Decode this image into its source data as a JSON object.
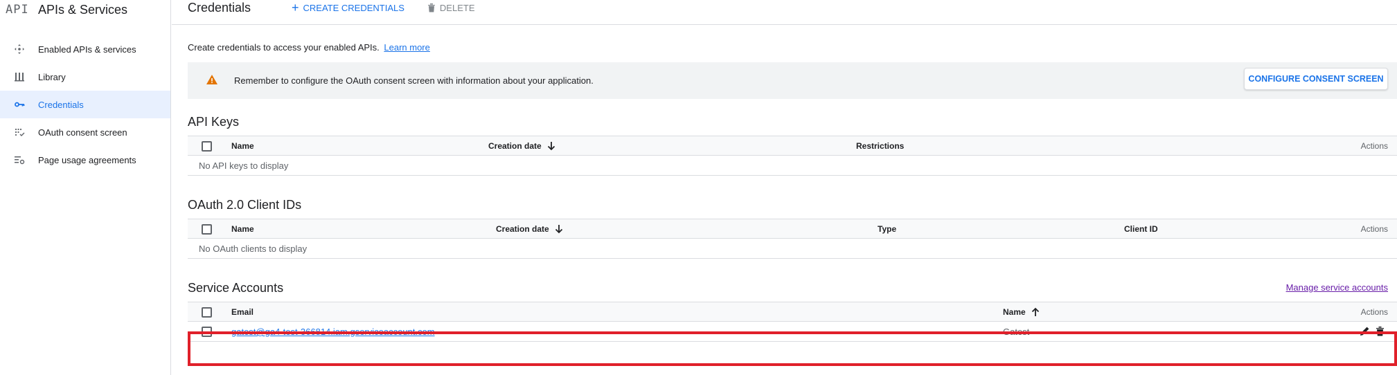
{
  "sidebar": {
    "logo": "API",
    "title": "APIs & Services",
    "items": [
      {
        "label": "Enabled APIs & services",
        "icon": "diamond-dots-icon"
      },
      {
        "label": "Library",
        "icon": "library-icon"
      },
      {
        "label": "Credentials",
        "icon": "key-icon",
        "active": true
      },
      {
        "label": "OAuth consent screen",
        "icon": "consent-dots-icon"
      },
      {
        "label": "Page usage agreements",
        "icon": "settings-list-icon"
      }
    ]
  },
  "header": {
    "title": "Credentials",
    "create_label": "CREATE CREDENTIALS",
    "delete_label": "DELETE"
  },
  "intro": {
    "text": "Create credentials to access your enabled APIs.",
    "link": "Learn more"
  },
  "banner": {
    "message": "Remember to configure the OAuth consent screen with information about your application.",
    "button": "CONFIGURE CONSENT SCREEN"
  },
  "api_keys": {
    "title": "API Keys",
    "columns": {
      "name": "Name",
      "created": "Creation date",
      "restrictions": "Restrictions",
      "actions": "Actions"
    },
    "empty": "No API keys to display"
  },
  "oauth": {
    "title": "OAuth 2.0 Client IDs",
    "columns": {
      "name": "Name",
      "created": "Creation date",
      "type": "Type",
      "client_id": "Client ID",
      "actions": "Actions"
    },
    "empty": "No OAuth clients to display"
  },
  "service_accounts": {
    "title": "Service Accounts",
    "manage_link": "Manage service accounts",
    "columns": {
      "email": "Email",
      "name": "Name",
      "actions": "Actions"
    },
    "rows": [
      {
        "email": "gatest@ga4-test-366814.iam.gserviceaccount.com",
        "name": "Gatest"
      }
    ]
  },
  "colors": {
    "accent": "#1a73e8",
    "warning": "#e37400",
    "highlight": "#e0202a"
  }
}
